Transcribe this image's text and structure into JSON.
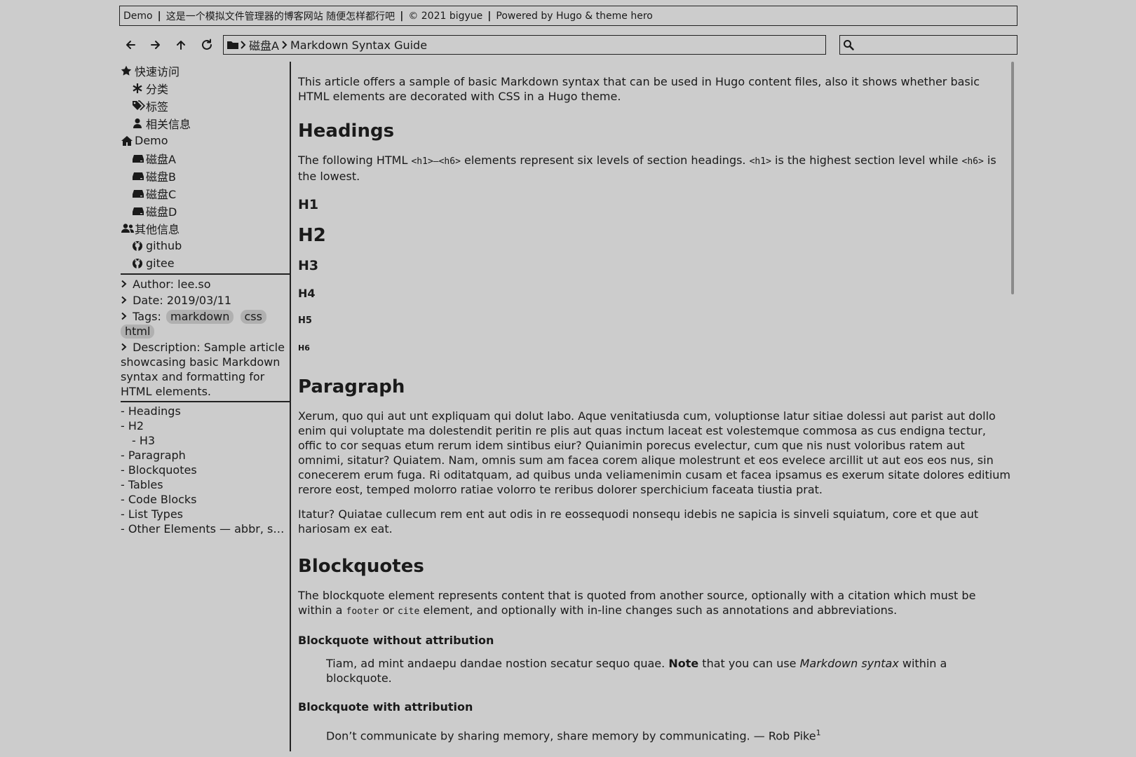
{
  "titlebar": {
    "items": [
      "Demo",
      "这是一个模拟文件管理器的博客网站 随便怎样都行吧",
      "© 2021 bigyue",
      "Powered by Hugo & theme hero"
    ],
    "separator": "|"
  },
  "toolbar": {
    "back_icon": "arrow-left-icon",
    "forward_icon": "arrow-right-icon",
    "up_icon": "arrow-up-icon",
    "refresh_icon": "refresh-icon",
    "breadcrumb": [
      "磁盘A",
      "Markdown Syntax Guide"
    ],
    "search_value": ""
  },
  "sidebar": {
    "quick_access": {
      "label": "快速访问",
      "items": [
        "分类",
        "标签",
        "相关信息"
      ]
    },
    "demo": {
      "label": "Demo",
      "items": [
        "磁盘A",
        "磁盘B",
        "磁盘C",
        "磁盘D"
      ]
    },
    "other": {
      "label": "其他信息",
      "items": [
        "github",
        "gitee"
      ]
    },
    "meta": {
      "author": "Author: lee.so",
      "date": "Date: 2019/03/11",
      "tags_label": "Tags:",
      "tags": [
        "markdown",
        "css",
        "html"
      ],
      "description_label": "Description:",
      "description": "Sample article showcasing basic Markdown syntax and formatting for HTML elements."
    },
    "toc": [
      {
        "label": "- Headings",
        "level": 1
      },
      {
        "label": "- H2",
        "level": 1
      },
      {
        "label": "- H3",
        "level": 2
      },
      {
        "label": "- Paragraph",
        "level": 1
      },
      {
        "label": "- Blockquotes",
        "level": 1
      },
      {
        "label": "- Tables",
        "level": 1
      },
      {
        "label": "- Code Blocks",
        "level": 1
      },
      {
        "label": "- List Types",
        "level": 1
      },
      {
        "label": "- Other Elements — abbr, su...",
        "level": 1
      }
    ]
  },
  "article": {
    "intro": "This article offers a sample of basic Markdown syntax that can be used in Hugo content files, also it shows whether basic HTML elements are decorated with CSS in a Hugo theme.",
    "headings_title": "Headings",
    "headings_text_1": "The following HTML ",
    "code_h1_h6": "<h1>—<h6>",
    "headings_text_2": " elements represent six levels of section headings. ",
    "code_h1": "<h1>",
    "headings_text_3": " is the highest section level while ",
    "code_h6": "<h6>",
    "headings_text_4": " is the lowest.",
    "h1": "H1",
    "h2": "H2",
    "h3": "H3",
    "h4": "H4",
    "h5": "H5",
    "h6": "H6",
    "paragraph_title": "Paragraph",
    "paragraph_1": "Xerum, quo qui aut unt expliquam qui dolut labo. Aque venitatiusda cum, voluptionse latur sitiae dolessi aut parist aut dollo enim qui voluptate ma dolestendit peritin re plis aut quas inctum laceat est volestemque commosa as cus endigna tectur, offic to cor sequas etum rerum idem sintibus eiur? Quianimin porecus evelectur, cum que nis nust voloribus ratem aut omnimi, sitatur? Quiatem. Nam, omnis sum am facea corem alique molestrunt et eos evelece arcillit ut aut eos eos nus, sin conecerem erum fuga. Ri oditatquam, ad quibus unda veliamenimin cusam et facea ipsamus es exerum sitate dolores editium rerore eost, temped molorro ratiae volorro te reribus dolorer sperchicium faceata tiustia prat.",
    "paragraph_2": "Itatur? Quiatae cullecum rem ent aut odis in re eossequodi nonsequ idebis ne sapicia is sinveli squiatum, core et que aut hariosam ex eat.",
    "blockquotes_title": "Blockquotes",
    "bq_text_1": "The blockquote element represents content that is quoted from another source, optionally with a citation which must be within a ",
    "code_footer": "footer",
    "bq_text_2": " or ",
    "code_cite": "cite",
    "bq_text_3": " element, and optionally with in-line changes such as annotations and abbreviations.",
    "bq_without_title": "Blockquote without attribution",
    "bq_without_1": "Tiam, ad mint andaepu dandae nostion secatur sequo quae. ",
    "bq_without_bold": "Note",
    "bq_without_2": " that you can use ",
    "bq_without_italic": "Markdown syntax",
    "bq_without_3": " within a blockquote.",
    "bq_with_title": "Blockquote with attribution",
    "bq_with_text": "Don’t communicate by sharing memory, share memory by communicating. — Rob Pike",
    "bq_with_sup": "1"
  }
}
